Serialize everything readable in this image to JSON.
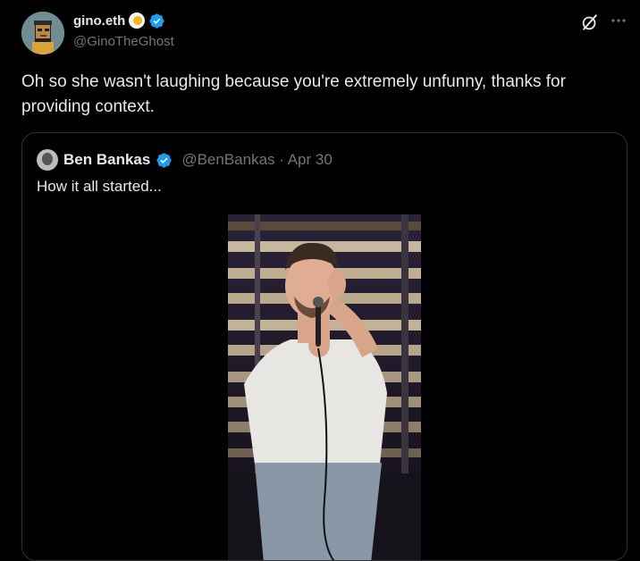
{
  "author": {
    "display_name": "gino.eth",
    "handle": "@GinoTheGhost"
  },
  "tweet": {
    "text": "Oh so she wasn't laughing because you're extremely unfunny, thanks for providing context."
  },
  "quoted": {
    "display_name": "Ben Bankas",
    "handle_date": "@BenBankas · Apr 30",
    "text": "How it all started..."
  },
  "icons": {
    "verified": "verified-badge-icon",
    "grok": "grok-icon",
    "more": "more-options-icon"
  },
  "colors": {
    "background": "#000000",
    "text": "#e7e9ea",
    "muted": "#71767b",
    "verified": "#1d9bf0",
    "border": "#2f3336"
  }
}
